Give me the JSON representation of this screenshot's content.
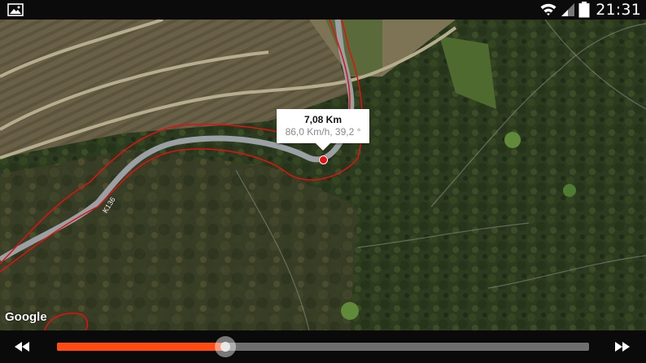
{
  "status_bar": {
    "time": "21:31",
    "icons": [
      "image-icon",
      "wifi-icon",
      "signal-icon",
      "battery-icon"
    ]
  },
  "map": {
    "road_label": "K136",
    "attribution": "Google",
    "route_color": "#e01212"
  },
  "info_window": {
    "distance": "7,08 Km",
    "speed_heading": "86,0 Km/h, 39,2 °"
  },
  "player": {
    "progress": 0.317,
    "accent_color": "#ff4a12",
    "controls": [
      "rewind-icon",
      "fast-forward-icon"
    ]
  }
}
